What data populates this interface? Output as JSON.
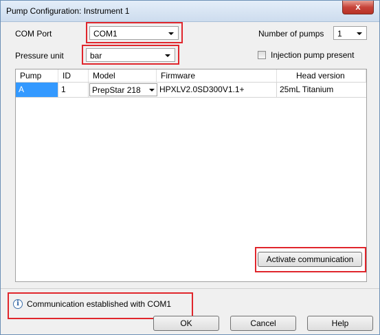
{
  "window": {
    "title": "Pump Configuration: Instrument 1",
    "close_glyph": "x"
  },
  "form": {
    "com_port_label": "COM Port",
    "com_port_value": "COM1",
    "pressure_unit_label": "Pressure unit",
    "pressure_unit_value": "bar",
    "num_pumps_label": "Number of pumps",
    "num_pumps_value": "1",
    "injection_label": "Injection pump present",
    "injection_checked": false
  },
  "table": {
    "columns": [
      "Pump",
      "ID",
      "Model",
      "Firmware",
      "Head version"
    ],
    "rows": [
      {
        "pump": "A",
        "id": "1",
        "model": "PrepStar 218",
        "firmware": "HPXLV2.0SD300V1.1+",
        "head_version": "25mL Titanium"
      }
    ]
  },
  "buttons": {
    "activate": "Activate communication",
    "ok": "OK",
    "cancel": "Cancel",
    "help": "Help"
  },
  "status": {
    "icon": "info-icon",
    "message": "Communication established with COM1"
  },
  "colors": {
    "highlight_box": "#e0252b",
    "selection": "#3399ff"
  }
}
